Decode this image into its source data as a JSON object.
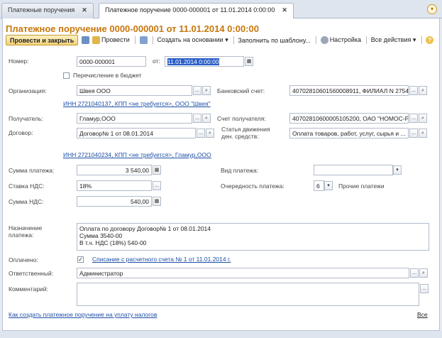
{
  "tabs": [
    {
      "label": "Платежные поручения",
      "close": "✕"
    },
    {
      "label": "Платежное поручение 0000-000001 от 11.01.2014 0:00:00",
      "close": "✕"
    }
  ],
  "title": "Платежное поручение 0000-000001 от 11.01.2014 0:00:00",
  "toolbar": {
    "post_close": "Провести и закрыть",
    "post": "Провести",
    "create_basis": "Создать на основании",
    "fill_template": "Заполнить по шаблону...",
    "settings": "Настройка",
    "all_actions": "Все действия",
    "help": "?"
  },
  "form": {
    "number_label": "Номер:",
    "number_value": "0000-000001",
    "from_label": "от:",
    "date_value": "11.01.2014  0:00:00",
    "budget_label": "Перечисление в бюджет",
    "org_label": "Организация:",
    "org_value": "Швея ООО",
    "bank_account_label": "Банковский счет:",
    "bank_account_value": "40702810601560008911, ФИЛИАЛ N 2754 ...",
    "org_inn_link": "ИНН 2721040137, КПП <не требуется>, ООО \"Швея\"",
    "recipient_label": "Получатель:",
    "recipient_value": "Гламур,ООО",
    "recipient_account_label": "Счет получателя:",
    "recipient_account_value": "40702810600005105200, ОАО \"НОМОС-РЕ",
    "contract_label": "Договор:",
    "contract_value": "Договор№ 1 от 08.01.2014",
    "cashflow_label_1": "Статья движения",
    "cashflow_label_2": "ден. средств:",
    "cashflow_value": "Оплата товаров, работ, услуг, сырья и ...",
    "recipient_inn_link": "ИНН 2721040234, КПП <не требуется>, Гламур,ООО",
    "sum_label": "Сумма платежа:",
    "sum_value": "3 540,00",
    "payment_type_label": "Вид платежа:",
    "payment_type_value": "",
    "vat_rate_label": "Ставка НДС:",
    "vat_rate_value": "18%",
    "priority_label": "Очередность платежа:",
    "priority_value": "6",
    "priority_text": "Прочие платежи",
    "vat_sum_label": "Сумма НДС:",
    "vat_sum_value": "540,00",
    "purpose_label_1": "Назначение",
    "purpose_label_2": "платежа:",
    "purpose_line_1": "Оплата по договору Договор№ 1 от 08.01.2014",
    "purpose_line_2": "Сумма 3540-00",
    "purpose_line_3": "В т.ч. НДС  (18%) 540-00",
    "paid_label": "Оплачено:",
    "paid_link": "Списание с расчетного счета № 1 от 11.01.2014 г.",
    "responsible_label": "Ответственный:",
    "responsible_value": "Администратор",
    "comment_label": "Комментарий:",
    "comment_value": ""
  },
  "footer": {
    "tax_link": "Как создать платежное поручение на уплату налогов",
    "all_link": "Все"
  }
}
